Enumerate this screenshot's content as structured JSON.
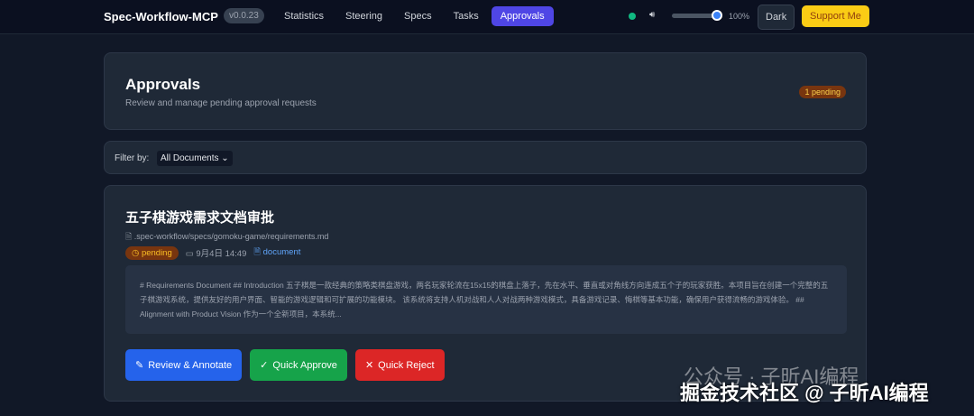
{
  "nav": {
    "brand": "Spec-Workflow-MCP",
    "version": "v0.0.23",
    "links": [
      "Statistics",
      "Steering",
      "Specs",
      "Tasks",
      "Approvals"
    ],
    "volume": "100%",
    "theme": "Dark",
    "support": "Support Me"
  },
  "header": {
    "title": "Approvals",
    "subtitle": "Review and manage pending approval requests",
    "badge": "1 pending"
  },
  "filter": {
    "label": "Filter by:",
    "value": "All Documents ⌄"
  },
  "approval": {
    "title": "五子棋游戏需求文档审批",
    "path": ".spec-workflow/specs/gomoku-game/requirements.md",
    "status": "pending",
    "date": "9月4日 14:49",
    "type": "document",
    "preview": "# Requirements Document ## Introduction 五子棋是一款经典的策略类棋盘游戏，两名玩家轮流在15x15的棋盘上落子，先在水平、垂直或对角线方向连成五个子的玩家获胜。本项目旨在创建一个完整的五子棋游戏系统，提供友好的用户界面、智能的游戏逻辑和可扩展的功能模块。 该系统将支持人机对战和人人对战两种游戏模式，具备游戏记录、悔棋等基本功能，确保用户获得流畅的游戏体验。 ## Alignment with Product Vision 作为一个全新项目，本系统...",
    "buttons": {
      "review": "Review & Annotate",
      "approve": "Quick Approve",
      "reject": "Quick Reject"
    }
  },
  "watermark": {
    "line1": "公众号 · 子昕AI编程",
    "line2": "掘金技术社区 @ 子昕AI编程"
  }
}
